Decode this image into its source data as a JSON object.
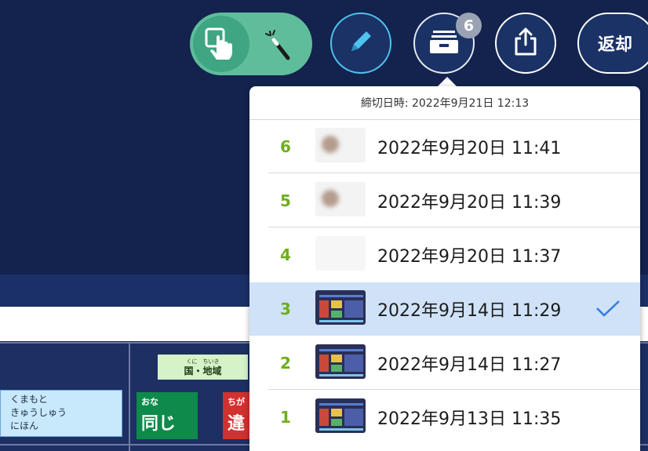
{
  "background": {
    "region_label_ruby": "くに　ちいき",
    "region_label": "国・地域",
    "place_card_lines": [
      "くまもと",
      "きゅうしゅう",
      "にほん"
    ],
    "same_card": {
      "ruby": "おな",
      "kanji": "同じ"
    },
    "diff_card": {
      "ruby": "ちが",
      "kanji": "違"
    }
  },
  "toolbar": {
    "mode_toggle": {
      "active": "touch",
      "icons": [
        "touch-icon",
        "magic-wand-icon"
      ]
    },
    "pen_icon": "pen-icon",
    "submission_box_icon": "inbox-tray-icon",
    "submission_count": "6",
    "share_icon": "share-icon",
    "return_label": "返却"
  },
  "dropdown": {
    "deadline": "締切日時: 2022年9月21日 12:13",
    "submissions": [
      {
        "number": "6",
        "datetime": "2022年9月20日 11:41",
        "thumbnail": "blurred-photo",
        "selected": false
      },
      {
        "number": "5",
        "datetime": "2022年9月20日 11:39",
        "thumbnail": "blurred-photo",
        "selected": false
      },
      {
        "number": "4",
        "datetime": "2022年9月20日 11:37",
        "thumbnail": "blank",
        "selected": false
      },
      {
        "number": "3",
        "datetime": "2022年9月14日 11:29",
        "thumbnail": "screen",
        "selected": true
      },
      {
        "number": "2",
        "datetime": "2022年9月14日 11:27",
        "thumbnail": "screen",
        "selected": false
      },
      {
        "number": "1",
        "datetime": "2022年9月13日 11:35",
        "thumbnail": "screen",
        "selected": false
      }
    ]
  },
  "colors": {
    "board": "#13234d",
    "toggle": "#60bd9b",
    "selected_row": "#cfe2f8",
    "number": "#6fae1c",
    "check": "#2f7be0"
  }
}
